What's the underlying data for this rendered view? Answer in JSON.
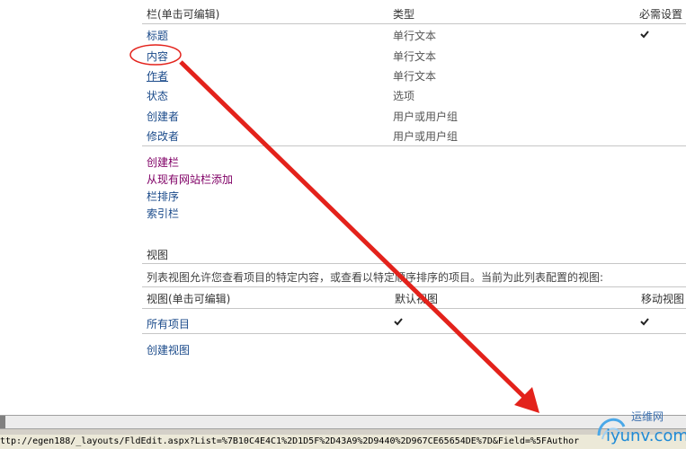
{
  "columns_table": {
    "header_name": "栏(单击可编辑)",
    "header_type": "类型",
    "header_required": "必需设置",
    "rows": [
      {
        "name": "标题",
        "type": "单行文本",
        "required": true
      },
      {
        "name": "内容",
        "type": "单行文本",
        "required": false
      },
      {
        "name": "作者",
        "type": "单行文本",
        "required": false
      },
      {
        "name": "状态",
        "type": "选项",
        "required": false
      },
      {
        "name": "创建者",
        "type": "用户或用户组",
        "required": false
      },
      {
        "name": "修改者",
        "type": "用户或用户组",
        "required": false
      }
    ]
  },
  "column_actions": [
    "创建栏",
    "从现有网站栏添加",
    "栏排序",
    "索引栏"
  ],
  "views_section": {
    "title": "视图",
    "description": "列表视图允许您查看项目的特定内容，或查看以特定顺序排序的项目。当前为此列表配置的视图:",
    "header_name": "视图(单击可编辑)",
    "header_default": "默认视图",
    "header_mobile": "移动视图",
    "rows": [
      {
        "name": "所有项目",
        "default": true,
        "mobile": true
      }
    ],
    "create_view": "创建视图"
  },
  "status_bar": {
    "url": "ttp://egen188/_layouts/FldEdit.aspx?List=%7B10C4E4C1%2D1D5F%2D43A9%2D9440%2D967CE65654DE%7D&Field=%5FAuthor"
  },
  "watermark": {
    "line1": "运维网",
    "line2": "iyunv.com"
  },
  "colors": {
    "annotation": "#e3221b",
    "link": "#1a4a8a",
    "action_link": "#800066"
  }
}
